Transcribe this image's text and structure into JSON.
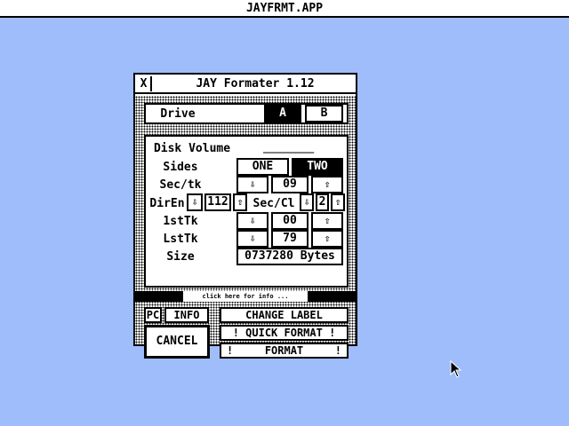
{
  "menubar": {
    "title": "JAYFRMT.APP"
  },
  "window": {
    "title": "JAY Formater 1.12",
    "close_glyph": "X"
  },
  "drive": {
    "label": "Drive",
    "options": [
      "A",
      "B"
    ],
    "selected": "A"
  },
  "params": {
    "disk_volume": {
      "label": "Disk Volume",
      "value": "__________"
    },
    "sides": {
      "label": "Sides",
      "options": [
        "ONE",
        "TWO"
      ],
      "selected": "TWO"
    },
    "sec_tk": {
      "label": "Sec/tk",
      "value": "09"
    },
    "dir_en": {
      "label": "DirEn",
      "value": "112"
    },
    "sec_cl": {
      "label": "Sec/Cl",
      "value": "2"
    },
    "first_tk": {
      "label": "1stTk",
      "value": "00"
    },
    "last_tk": {
      "label": "LstTk",
      "value": "79"
    },
    "size": {
      "label": "Size",
      "value": "0737280 Bytes"
    }
  },
  "info_hint": "click here for info ...",
  "actions": {
    "pc": "PC",
    "info": "INFO",
    "cancel": "CANCEL",
    "change_label": "CHANGE LABEL",
    "quick_format": "! QUICK FORMAT !",
    "format_left": "!",
    "format": "FORMAT",
    "format_right": "!"
  },
  "icons": {
    "down_arrow": "⇩",
    "up_arrow": "⇧"
  }
}
